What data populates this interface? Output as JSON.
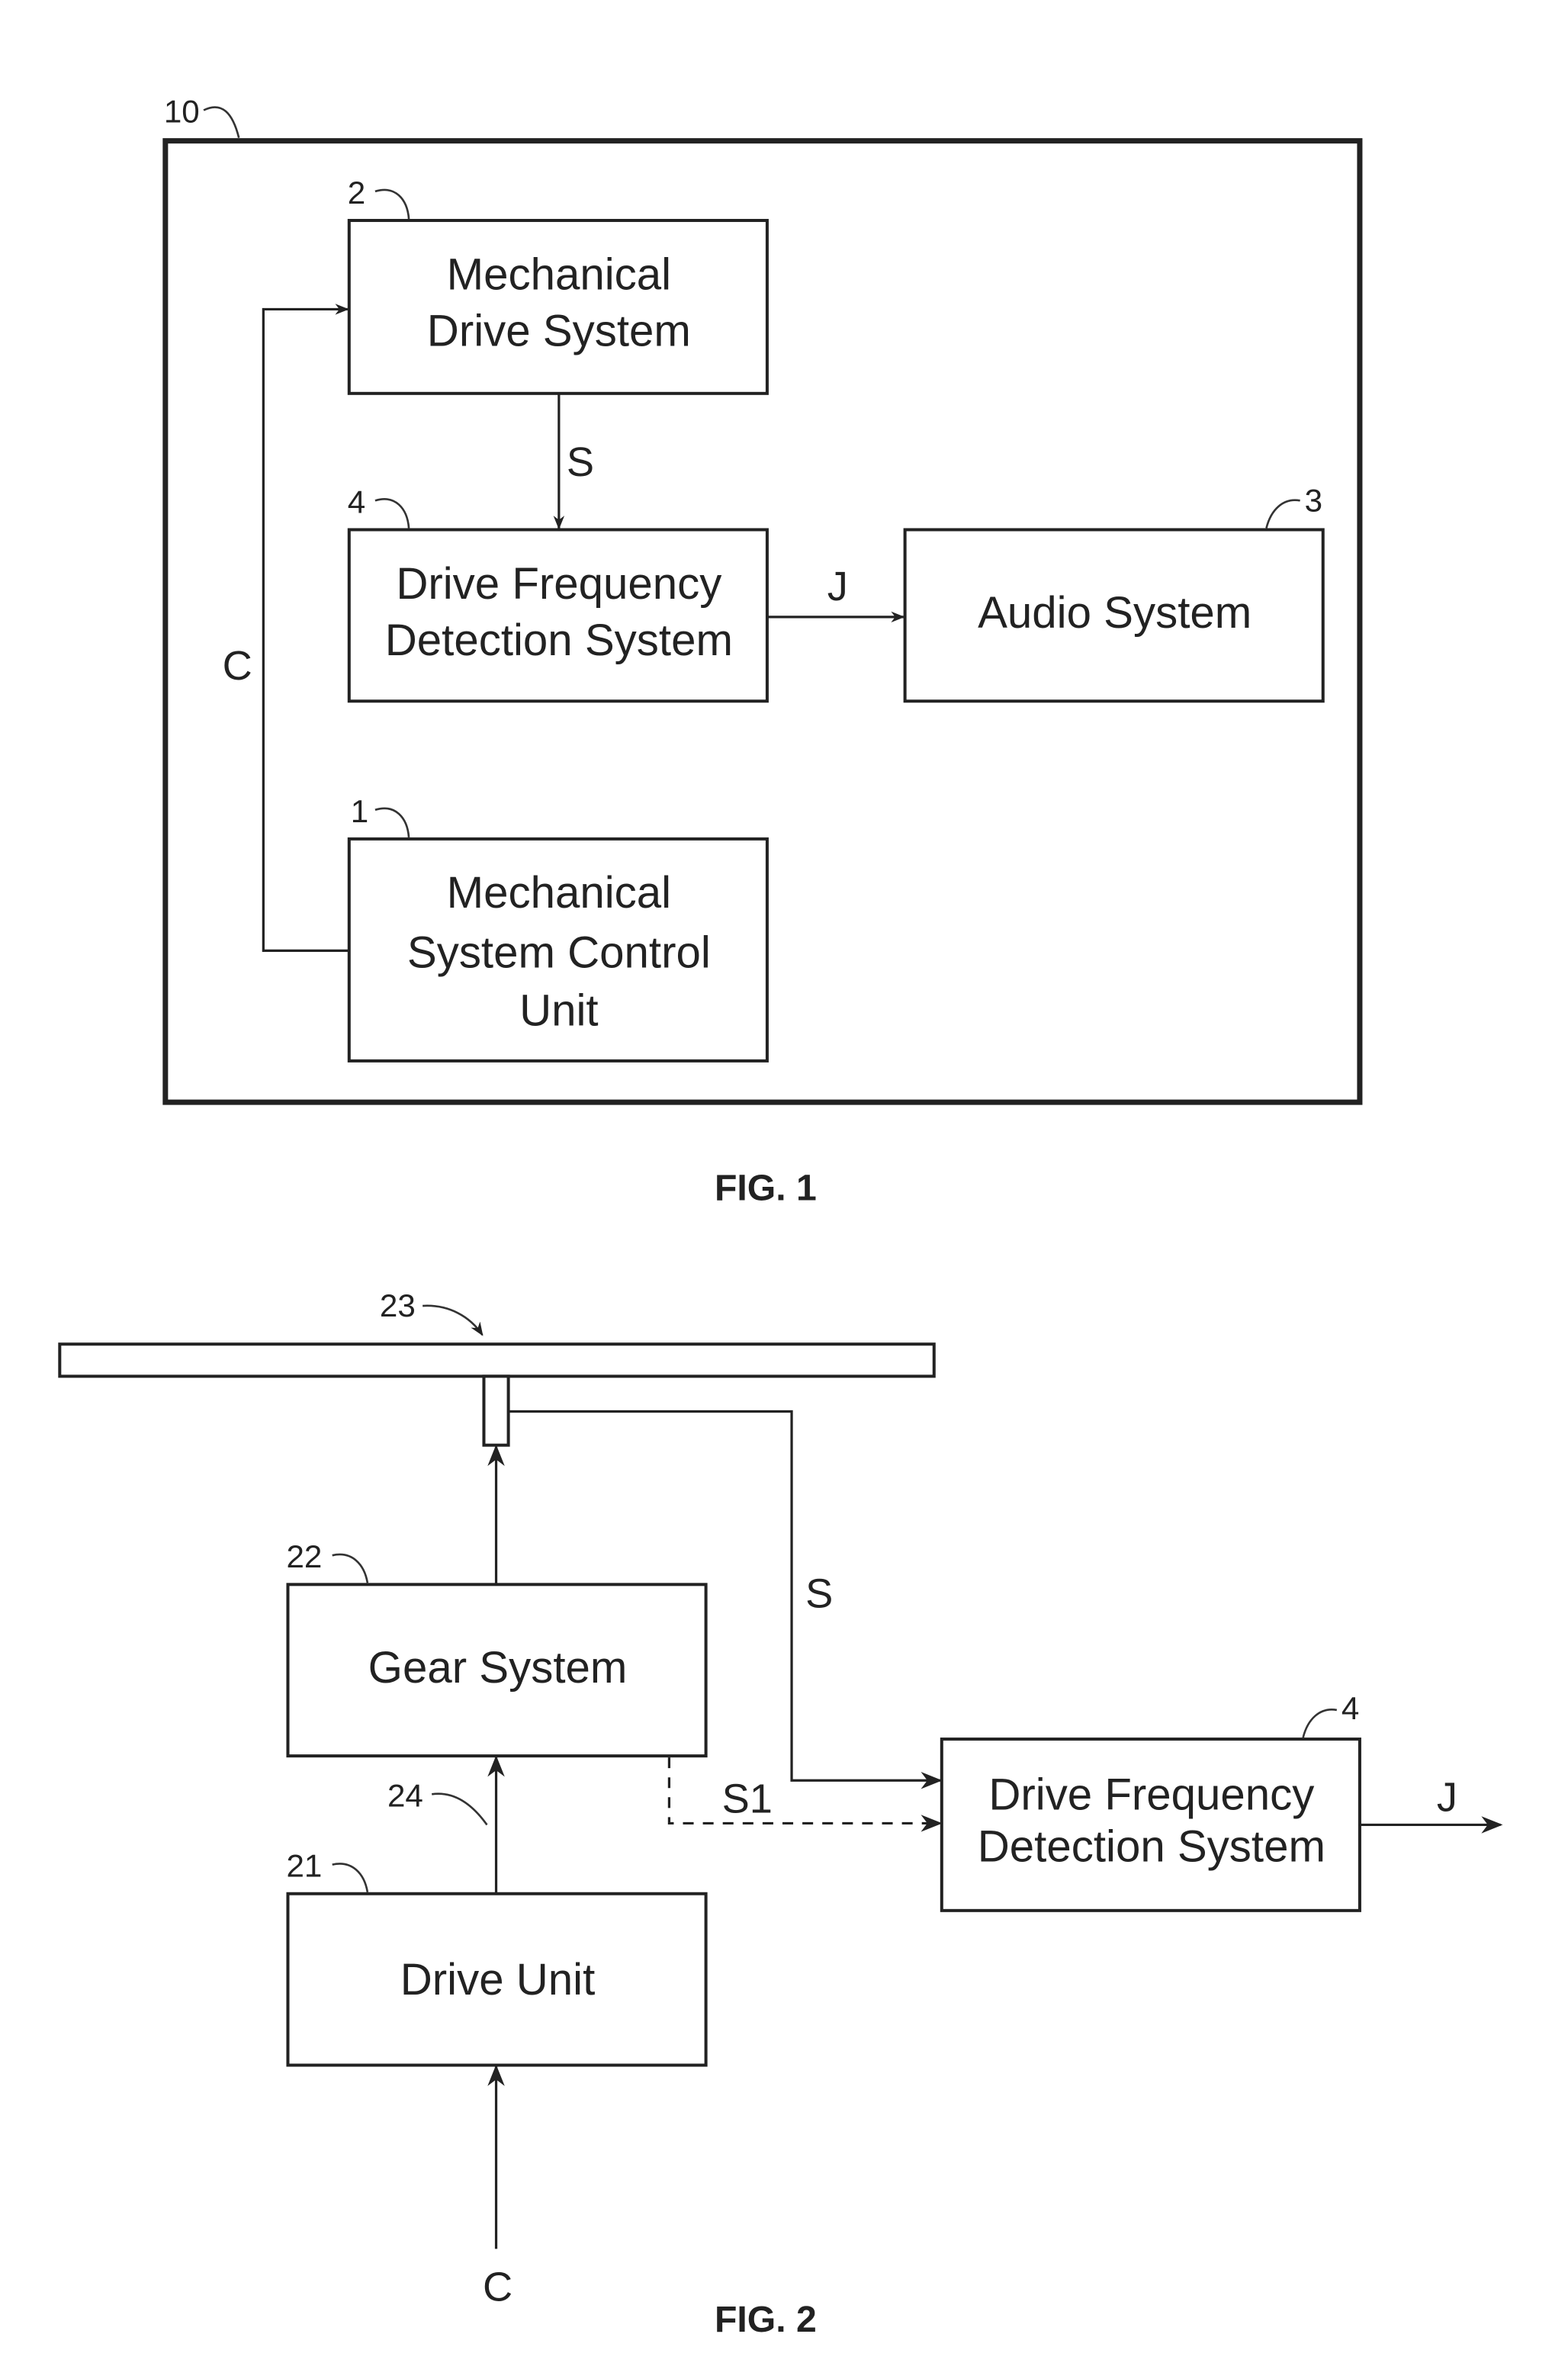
{
  "fig1": {
    "caption": "FIG. 1",
    "container_ref": "10",
    "blocks": {
      "mechanical_drive_system": {
        "ref": "2",
        "lines": [
          "Mechanical",
          "Drive System"
        ]
      },
      "drive_frequency_detection": {
        "ref": "4",
        "lines": [
          "Drive Frequency",
          "Detection System"
        ]
      },
      "audio_system": {
        "ref": "3",
        "lines": [
          "Audio System"
        ]
      },
      "control_unit": {
        "ref": "1",
        "lines": [
          "Mechanical",
          "System Control",
          "Unit"
        ]
      }
    },
    "signals": {
      "s": "S",
      "j": "J",
      "c": "C"
    }
  },
  "fig2": {
    "caption": "FIG. 2",
    "plate_ref": "23",
    "shaft_ref": "24",
    "blocks": {
      "gear_system": {
        "ref": "22",
        "lines": [
          "Gear System"
        ]
      },
      "drive_unit": {
        "ref": "21",
        "lines": [
          "Drive Unit"
        ]
      },
      "drive_frequency_detection": {
        "ref": "4",
        "lines": [
          "Drive Frequency",
          "Detection System"
        ]
      }
    },
    "signals": {
      "s": "S",
      "s1": "S1",
      "j": "J",
      "c": "C"
    }
  }
}
